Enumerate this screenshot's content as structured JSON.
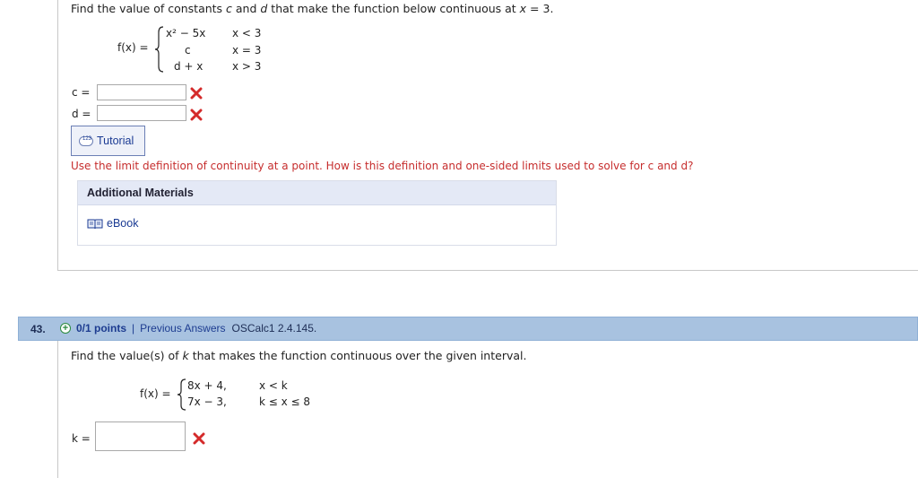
{
  "question1": {
    "prompt_part1": "Find the value of constants ",
    "c_var": "c",
    "prompt_and": " and ",
    "d_var": "d",
    "prompt_part2": " that make the function below continuous at ",
    "x_var": "x",
    "prompt_end": " = 3.",
    "fx_label": "f(x) =",
    "cases": [
      {
        "expr": "x² − 5x",
        "cond": "x < 3"
      },
      {
        "expr": "c",
        "cond": "x = 3"
      },
      {
        "expr": "d + x",
        "cond": "x > 3"
      }
    ],
    "answers": [
      {
        "label": "c =",
        "value": ""
      },
      {
        "label": "d =",
        "value": ""
      }
    ],
    "tutorial_label": "Tutorial",
    "tutorial_icon_text": "123",
    "hint": "Use the limit definition of continuity at a point. How is this definition and one-sided limits used to solve for c and d?",
    "additional_materials": {
      "title": "Additional Materials",
      "ebook_label": "eBook"
    }
  },
  "question2": {
    "number": "43.",
    "points": "0/1 points",
    "previous_answers": "Previous Answers",
    "code": "OSCalc1 2.4.145.",
    "prompt_part1": "Find the value(s) of ",
    "k_var": "k",
    "prompt_part2": " that makes the function continuous over the given interval.",
    "fx_label": "f(x) =",
    "cases": [
      {
        "expr": "8x + 4,",
        "cond": "x < k"
      },
      {
        "expr": "7x − 3,",
        "cond": "k ≤ x ≤ 8"
      }
    ],
    "answer": {
      "label": "k =",
      "value": ""
    }
  },
  "colors": {
    "header_bg": "#a8c2e0",
    "link": "#1a3a93",
    "hint": "#c62d2d",
    "wrong": "#d42a2a"
  }
}
